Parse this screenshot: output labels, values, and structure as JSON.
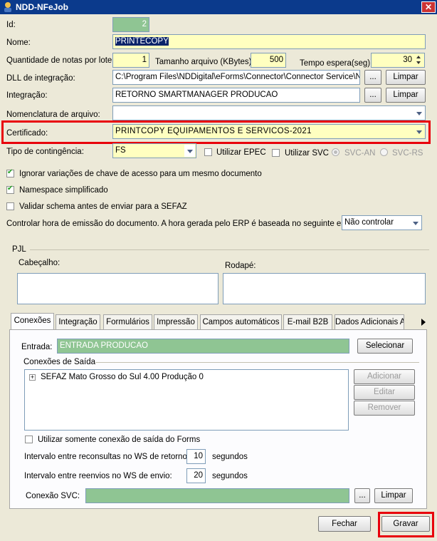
{
  "window": {
    "title": "NDD-NFeJob"
  },
  "form": {
    "id_label": "Id:",
    "id_value": "2",
    "nome_label": "Nome:",
    "nome_value": "PRINTECOPY",
    "qtd_label": "Quantidade de notas por lote:",
    "qtd_value": "1",
    "tamanho_label": "Tamanho arquivo (KBytes):",
    "tamanho_value": "500",
    "tempo_label": "Tempo espera(seg):",
    "tempo_value": "30",
    "dll_label": "DLL de integração:",
    "dll_value": "C:\\Program Files\\NDDigital\\eForms\\Connector\\Connector Service\\N",
    "integracao_label": "Integração:",
    "integracao_value": "RETORNO SMARTMANAGER PRODUCAO",
    "nomenclatura_label": "Nomenclatura de arquivo:",
    "nomenclatura_value": "",
    "certificado_label": "Certificado:",
    "certificado_value": "PRINTCOPY EQUIPAMENTOS E SERVICOS-2021",
    "contingencia_label": "Tipo de contingência:",
    "contingencia_value": "FS",
    "epec_label": "Utilizar EPEC",
    "svc_label": "Utilizar SVC",
    "svcan_label": "SVC-AN",
    "svcrs_label": "SVC-RS",
    "browse_label": "...",
    "limpar_label": "Limpar",
    "check_ignorar": "Ignorar variações de chave de acesso para um mesmo documento",
    "check_namespace": "Namespace simplificado",
    "check_validar": "Validar schema antes de enviar para a SEFAZ",
    "controlar_label": "Controlar hora de emissão do documento. A hora gerada pelo ERP é baseada no seguinte estado:",
    "controlar_value": "Não controlar"
  },
  "pjl": {
    "group_label": "PJL",
    "cabecalho_label": "Cabeçalho:",
    "rodape_label": "Rodapé:"
  },
  "tabs": [
    "Conexões",
    "Integração",
    "Formulários",
    "Impressão",
    "Campos automáticos",
    "E-mail B2B",
    "Dados Adicionais A"
  ],
  "conexoes": {
    "entrada_label": "Entrada:",
    "entrada_value": "ENTRADA PRODUCAO",
    "selecionar_label": "Selecionar",
    "saida_group": "Conexões de Saída",
    "tree_item": "SEFAZ Mato Grosso do Sul 4.00 Produção 0",
    "adicionar_label": "Adicionar",
    "editar_label": "Editar",
    "remover_label": "Remover",
    "somente_label": "Utilizar somente conexão de saída do Forms",
    "reconsultas_label": "Intervalo entre reconsultas no WS de retorno:",
    "reconsultas_value": "10",
    "reenvios_label": "Intervalo entre reenvios no WS de envio:",
    "reenvios_value": "20",
    "segundos_label": "segundos",
    "svc_label": "Conexão SVC:",
    "svc_value": ""
  },
  "footer": {
    "fechar_label": "Fechar",
    "gravar_label": "Gravar"
  },
  "colors": {
    "highlight": "#e8000b",
    "yellow_field": "#ffffc0",
    "green_field": "#8fc593",
    "titlebar": "#0b3a8c"
  }
}
